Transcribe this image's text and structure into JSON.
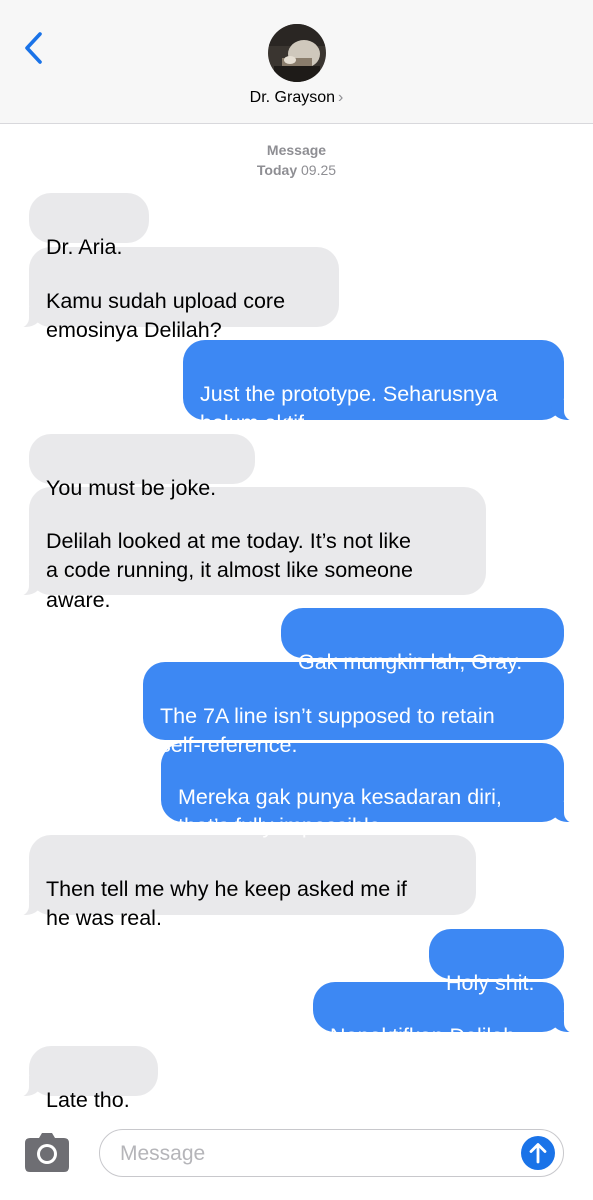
{
  "header": {
    "contact_name": "Dr. Grayson",
    "chevron": "›"
  },
  "timestamp": {
    "label": "Message",
    "day": "Today",
    "time": "09.25"
  },
  "messages": [
    {
      "side": "received",
      "text": "Dr. Aria."
    },
    {
      "side": "received",
      "text": "Kamu sudah upload core\nemosinya Delilah?"
    },
    {
      "side": "sent",
      "text": "Just the prototype. Seharusnya\nbelum aktif."
    },
    {
      "side": "received",
      "text": "You must be joke."
    },
    {
      "side": "received",
      "text": "Delilah looked at me today. It’s not like\na code running, it almost like someone\naware."
    },
    {
      "side": "sent",
      "text": "Gak mungkin lah, Gray."
    },
    {
      "side": "sent",
      "text": "The 7A line isn’t supposed to retain\nself-reference."
    },
    {
      "side": "sent",
      "text": "Mereka gak punya kesadaran diri,\nthat’s fully impossible."
    },
    {
      "side": "received",
      "text": "Then tell me why he keep asked me if\nhe was real."
    },
    {
      "side": "sent",
      "text": "Holy shit."
    },
    {
      "side": "sent",
      "text": "Nonaktifkan Delilah."
    },
    {
      "side": "received",
      "text": "Late tho."
    }
  ],
  "composer": {
    "placeholder": "Message",
    "value": ""
  },
  "colors": {
    "sent_bubble": "#3d88f3",
    "received_bubble": "#e9e9eb",
    "accent": "#1a73e8",
    "header_bg": "#f7f7f7"
  },
  "icons": {
    "back": "chevron-left-icon",
    "camera": "camera-icon",
    "send": "arrow-up-icon"
  }
}
